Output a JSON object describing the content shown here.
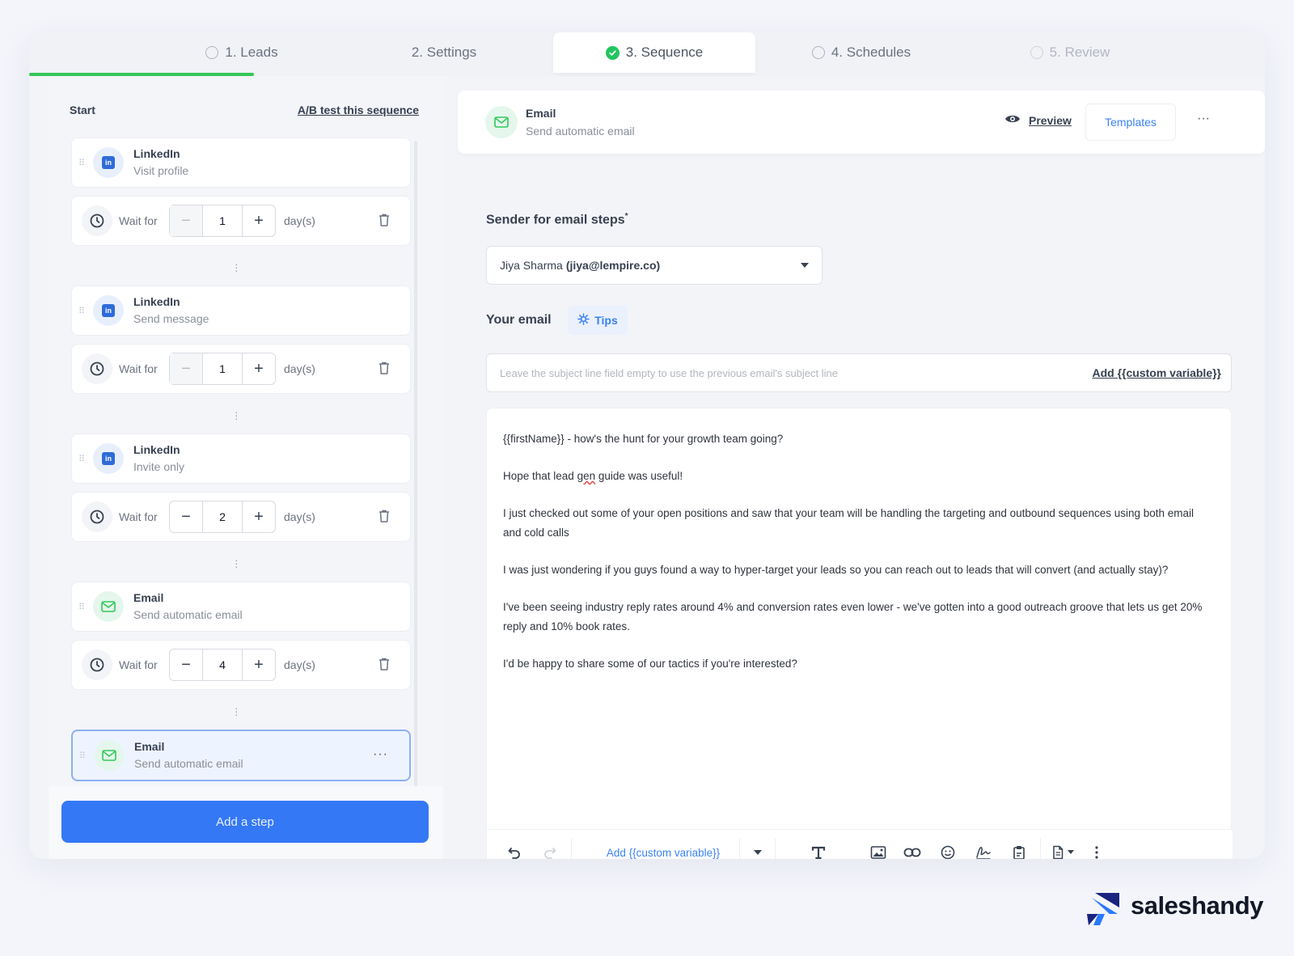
{
  "stepper": {
    "steps": [
      {
        "label": "1. Leads"
      },
      {
        "label": "2. Settings"
      },
      {
        "label": "3. Sequence"
      },
      {
        "label": "4. Schedules"
      },
      {
        "label": "5. Review"
      }
    ],
    "progress_fraction": 0.2
  },
  "sequence": {
    "start_label": "Start",
    "ab_test_link": "A/B test this sequence",
    "steps": [
      {
        "title": "LinkedIn",
        "subtitle": "Visit profile"
      },
      {
        "title": "LinkedIn",
        "subtitle": "Send message"
      },
      {
        "title": "LinkedIn",
        "subtitle": "Invite only"
      },
      {
        "title": "Email",
        "subtitle": "Send automatic email"
      },
      {
        "title": "Email",
        "subtitle": "Send automatic email"
      }
    ],
    "waits": [
      {
        "label": "Wait for",
        "value": "1",
        "unit": "day(s)"
      },
      {
        "label": "Wait for",
        "value": "1",
        "unit": "day(s)"
      },
      {
        "label": "Wait for",
        "value": "2",
        "unit": "day(s)"
      },
      {
        "label": "Wait for",
        "value": "4",
        "unit": "day(s)"
      }
    ],
    "add_step_label": "Add a step"
  },
  "editor": {
    "header_title": "Email",
    "header_subtitle": "Send automatic email",
    "preview_label": "Preview",
    "templates_label": "Templates",
    "sender_label": "Sender for email steps",
    "sender_required_mark": "*",
    "sender_name": "Jiya Sharma",
    "sender_email": "(jiya@lempire.co)",
    "your_email_label": "Your email",
    "tips_label": "Tips",
    "subject_placeholder": "Leave the subject line field empty to use the previous email's subject line",
    "subject_variable_link": "Add {{custom variable}}",
    "body": {
      "line1": "{{firstName}} - how's the hunt for your growth team going?",
      "line2_a": "Hope that lead ",
      "line2_b": "gen",
      "line2_c": " guide was useful!",
      "line3": "I just checked out some of your open positions and saw that your team will be handling the targeting and outbound sequences using both email and cold calls",
      "line4": "I was just wondering if you guys found a way to hyper-target your leads so you can reach out to leads that will convert (and actually stay)?",
      "line5": "I've been seeing industry reply rates around 4% and conversion rates even lower - we've gotten into a good outreach groove that lets us get 20% reply and 10% book rates.",
      "line6": "I'd be happy to share some of our tactics if you're interested?"
    },
    "toolbar_variable_label": "Add {{custom variable}}"
  },
  "brand": {
    "name": "saleshandy",
    "colors": {
      "accent": "#3478f6",
      "success": "#34c759",
      "brand_dark": "#1a237e",
      "brand_blue": "#2979ff"
    }
  },
  "icons": [
    "radio-circle-icon",
    "check-circle-icon",
    "linkedin-icon",
    "mail-icon",
    "clock-icon",
    "trash-icon",
    "drag-handle-icon",
    "eye-icon",
    "gear-icon",
    "undo-icon",
    "redo-icon",
    "text-format-icon",
    "image-icon",
    "link-icon",
    "emoji-icon",
    "signature-icon",
    "clipboard-icon",
    "document-icon",
    "more-vertical-icon"
  ]
}
